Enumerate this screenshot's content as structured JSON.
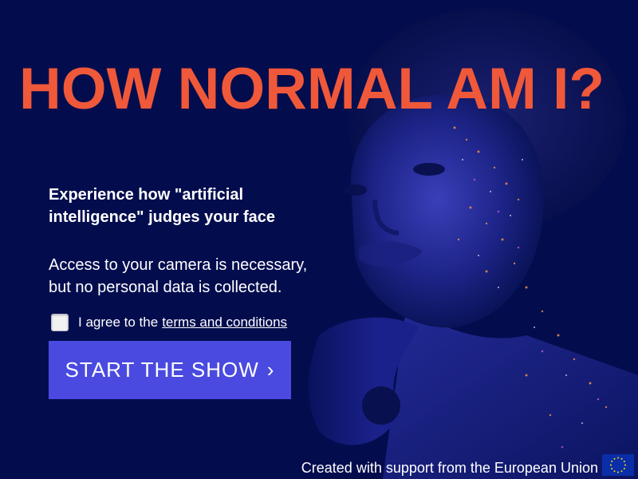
{
  "hero": {
    "headline": "HOW NORMAL AM I?"
  },
  "intro": {
    "subheading": "Experience how \"artificial intelligence\" judges your face",
    "notice": "Access to your camera is necessary, but no personal data is collected."
  },
  "consent": {
    "prefix": "I agree to the",
    "link_label": "terms and conditions",
    "checked": false
  },
  "cta": {
    "label": "START THE SHOW",
    "chevron": "›"
  },
  "footer": {
    "credit": "Created with support from the European Union"
  },
  "colors": {
    "background": "#030d4e",
    "headline": "#f0583a",
    "button": "#4a4ae0",
    "text": "#ffffff",
    "eu_flag": "#0a2ea8",
    "eu_stars": "#ffdd00"
  },
  "icons": {
    "checkbox": "checkbox-unchecked-icon",
    "eu_flag": "eu-flag-icon",
    "chevron": "chevron-right-icon"
  }
}
